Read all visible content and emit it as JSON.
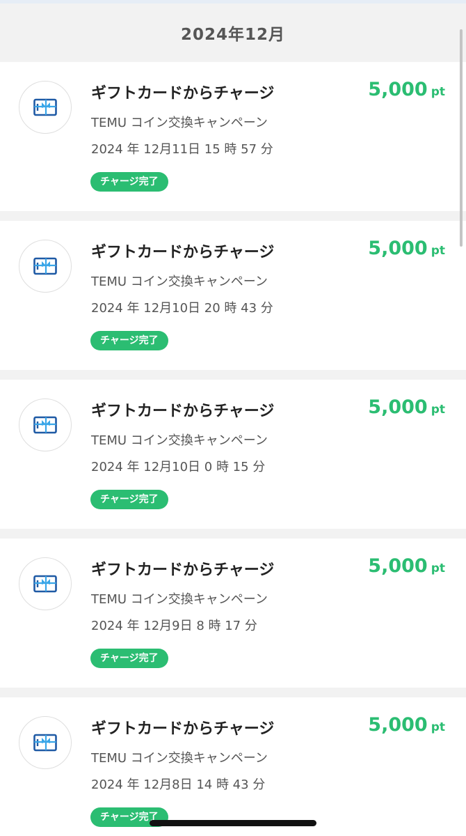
{
  "month_header": "2024年12月",
  "colors": {
    "accent": "#2bbd72",
    "icon_blue": "#1f5aa5",
    "ribbon": "#39a6e8"
  },
  "items": [
    {
      "title": "ギフトカードからチャージ",
      "subtitle": "TEMU コイン交換キャンペーン",
      "date": "2024 年 12月11日 15 時 57 分",
      "status": "チャージ完了",
      "amount": "5,000",
      "unit": "pt",
      "icon": "gift-card-icon"
    },
    {
      "title": "ギフトカードからチャージ",
      "subtitle": "TEMU コイン交換キャンペーン",
      "date": "2024 年 12月10日 20 時 43 分",
      "status": "チャージ完了",
      "amount": "5,000",
      "unit": "pt",
      "icon": "gift-card-icon"
    },
    {
      "title": "ギフトカードからチャージ",
      "subtitle": "TEMU コイン交換キャンペーン",
      "date": "2024 年 12月10日 0 時 15 分",
      "status": "チャージ完了",
      "amount": "5,000",
      "unit": "pt",
      "icon": "gift-card-icon"
    },
    {
      "title": "ギフトカードからチャージ",
      "subtitle": "TEMU コイン交換キャンペーン",
      "date": "2024 年 12月9日 8 時 17 分",
      "status": "チャージ完了",
      "amount": "5,000",
      "unit": "pt",
      "icon": "gift-card-icon"
    },
    {
      "title": "ギフトカードからチャージ",
      "subtitle": "TEMU コイン交換キャンペーン",
      "date": "2024 年 12月8日 14 時 43 分",
      "status": "チャージ完了",
      "amount": "5,000",
      "unit": "pt",
      "icon": "gift-card-icon"
    }
  ]
}
